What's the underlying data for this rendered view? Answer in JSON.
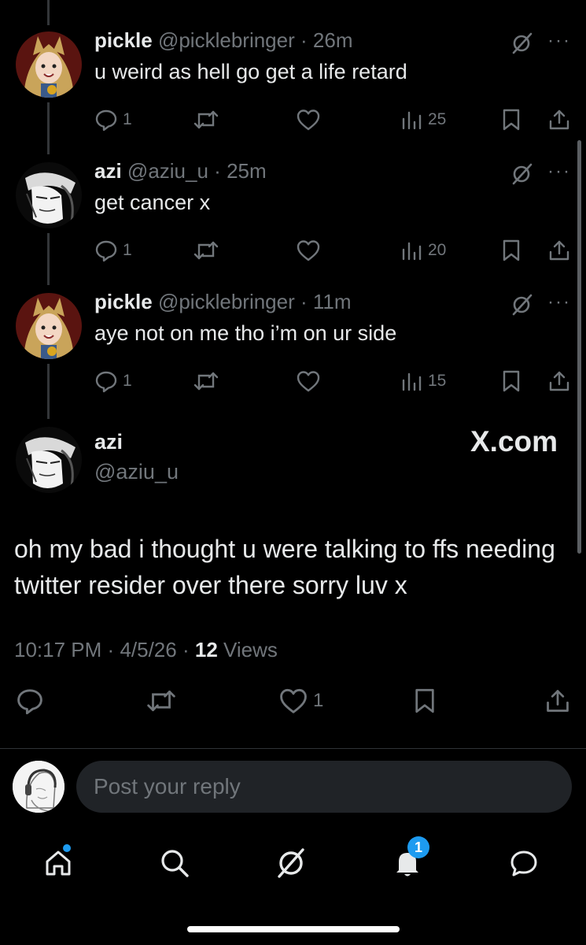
{
  "replies": [
    {
      "name": "pickle",
      "handle": "@picklebringer",
      "time": "26m",
      "text": "u weird as hell go get a life retard",
      "reply_count": "1",
      "views": "25",
      "avatar_icon": "anime-girl-avatar"
    },
    {
      "name": "azi",
      "handle": "@aziu_u",
      "time": "25m",
      "text": "get cancer x",
      "reply_count": "1",
      "views": "20",
      "avatar_icon": "sketch-portrait-avatar"
    },
    {
      "name": "pickle",
      "handle": "@picklebringer",
      "time": "11m",
      "text": "aye not on me tho i’m on ur side",
      "reply_count": "1",
      "views": "15",
      "avatar_icon": "anime-girl-avatar"
    }
  ],
  "meta_separator": "·",
  "more_label": "···",
  "main_post": {
    "name": "azi",
    "handle": "@aziu_u",
    "watermark": "X.com",
    "text": "oh my bad i thought u were talking to ffs needing twitter resider over there sorry luv x",
    "time": "10:17 PM",
    "date": "4/5/26",
    "views_count": "12",
    "views_label": "Views",
    "like_count": "1"
  },
  "composer": {
    "placeholder": "Post your reply"
  },
  "tabbar": {
    "notification_count": "1",
    "items": [
      "home-icon",
      "search-icon",
      "grok-icon",
      "notifications-icon",
      "messages-icon"
    ]
  },
  "colors": {
    "background": "#000000",
    "text": "#e7e9ea",
    "muted": "#71767b",
    "accent": "#1d9bf0"
  }
}
